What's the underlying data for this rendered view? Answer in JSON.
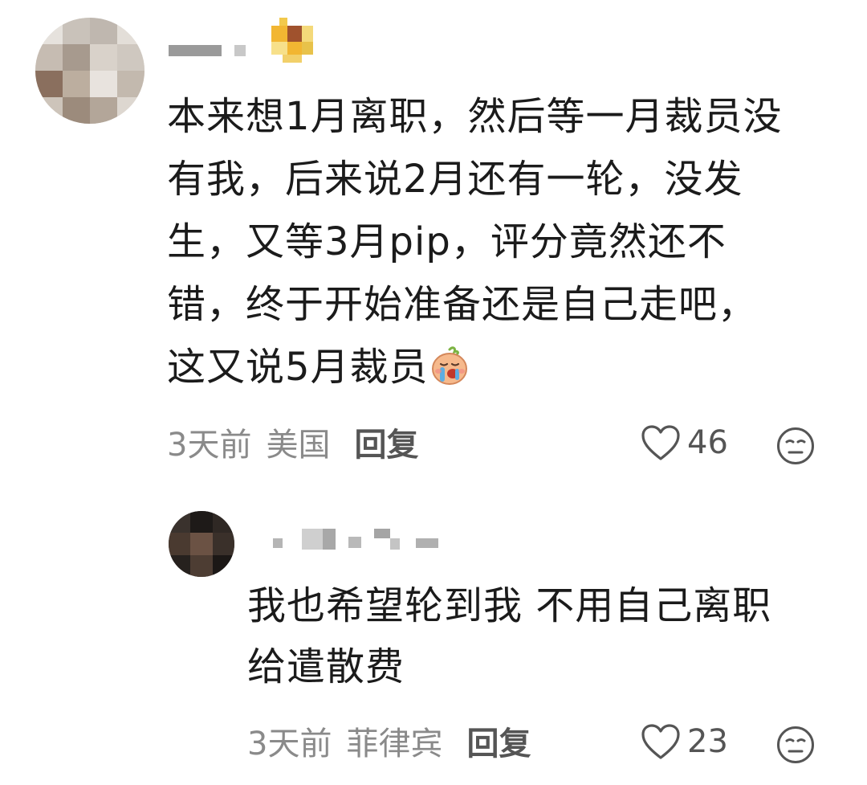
{
  "comment": {
    "text": "本来想1月离职，然后等一月裁员没有我，后来说2月还有一轮，没发生，又等3月pip，评分竟然还不错，终于开始准备还是自己走吧，这又说5月裁员",
    "lines": [
      "本来想1月离职，然后等一月裁员没",
      "有我，后来说2月还有一轮，没发",
      "生，又等3月pip，评分竟然还不",
      "错，终于开始准备还是自己走吧，",
      "这又说5月裁员"
    ],
    "emoji": "crying-face-emoji",
    "time": "3天前",
    "location": "美国",
    "reply_label": "回复",
    "likes": "46"
  },
  "reply": {
    "lines": [
      "我也希望轮到我 不用自己离职",
      "给遣散费"
    ],
    "time": "3天前",
    "location": "菲律宾",
    "reply_label": "回复",
    "likes": "23"
  },
  "icons": {
    "like": "heart-outline-icon",
    "dislike": "neutral-face-icon"
  }
}
